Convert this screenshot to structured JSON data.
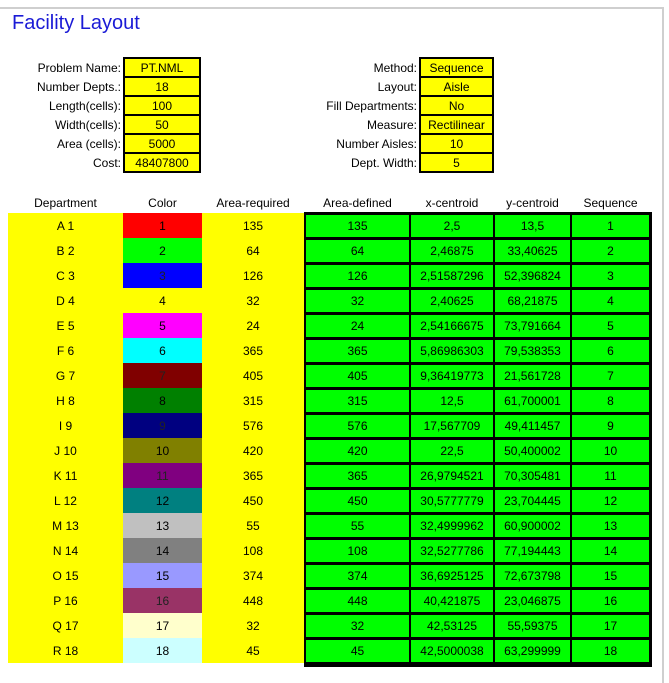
{
  "title": "Facility Layout",
  "left_params": [
    {
      "label": "Problem Name:",
      "value": "PT.NML"
    },
    {
      "label": "Number Depts.:",
      "value": "18"
    },
    {
      "label": "Length(cells):",
      "value": "100"
    },
    {
      "label": "Width(cells):",
      "value": "50"
    },
    {
      "label": "Area (cells):",
      "value": "5000"
    },
    {
      "label": "Cost:",
      "value": "48407800"
    }
  ],
  "right_params": [
    {
      "label": "Method:",
      "value": "Sequence"
    },
    {
      "label": "Layout:",
      "value": "Aisle"
    },
    {
      "label": "Fill Departments:",
      "value": "No"
    },
    {
      "label": "Measure:",
      "value": "Rectilinear"
    },
    {
      "label": "Number Aisles:",
      "value": "10"
    },
    {
      "label": "Dept. Width:",
      "value": "5"
    }
  ],
  "table": {
    "headers": [
      "Department",
      "Color",
      "Area-required",
      "Area-defined",
      "x-centroid",
      "y-centroid",
      "Sequence"
    ],
    "rows": [
      {
        "dept": "A 1",
        "color": "1",
        "color_hex": "#ff0000",
        "area_req": "135",
        "area_def": "135",
        "x": "2,5",
        "y": "13,5",
        "seq": "1"
      },
      {
        "dept": "B 2",
        "color": "2",
        "color_hex": "#00ff00",
        "area_req": "64",
        "area_def": "64",
        "x": "2,46875",
        "y": "33,40625",
        "seq": "2"
      },
      {
        "dept": "C 3",
        "color": "3",
        "color_hex": "#0000ff",
        "area_req": "126",
        "area_def": "126",
        "x": "2,51587296",
        "y": "52,396824",
        "seq": "3"
      },
      {
        "dept": "D 4",
        "color": "4",
        "color_hex": "#ffff00",
        "area_req": "32",
        "area_def": "32",
        "x": "2,40625",
        "y": "68,21875",
        "seq": "4"
      },
      {
        "dept": "E 5",
        "color": "5",
        "color_hex": "#ff00ff",
        "area_req": "24",
        "area_def": "24",
        "x": "2,54166675",
        "y": "73,791664",
        "seq": "5"
      },
      {
        "dept": "F 6",
        "color": "6",
        "color_hex": "#00ffff",
        "area_req": "365",
        "area_def": "365",
        "x": "5,86986303",
        "y": "79,538353",
        "seq": "6"
      },
      {
        "dept": "G 7",
        "color": "7",
        "color_hex": "#800000",
        "area_req": "405",
        "area_def": "405",
        "x": "9,36419773",
        "y": "21,561728",
        "seq": "7"
      },
      {
        "dept": "H 8",
        "color": "8",
        "color_hex": "#008000",
        "area_req": "315",
        "area_def": "315",
        "x": "12,5",
        "y": "61,700001",
        "seq": "8"
      },
      {
        "dept": "I 9",
        "color": "9",
        "color_hex": "#000080",
        "area_req": "576",
        "area_def": "576",
        "x": "17,567709",
        "y": "49,411457",
        "seq": "9"
      },
      {
        "dept": "J 10",
        "color": "10",
        "color_hex": "#808000",
        "area_req": "420",
        "area_def": "420",
        "x": "22,5",
        "y": "50,400002",
        "seq": "10"
      },
      {
        "dept": "K 11",
        "color": "11",
        "color_hex": "#800080",
        "area_req": "365",
        "area_def": "365",
        "x": "26,9794521",
        "y": "70,305481",
        "seq": "11"
      },
      {
        "dept": "L 12",
        "color": "12",
        "color_hex": "#008080",
        "area_req": "450",
        "area_def": "450",
        "x": "30,5777779",
        "y": "23,704445",
        "seq": "12"
      },
      {
        "dept": "M 13",
        "color": "13",
        "color_hex": "#c0c0c0",
        "area_req": "55",
        "area_def": "55",
        "x": "32,4999962",
        "y": "60,900002",
        "seq": "13"
      },
      {
        "dept": "N 14",
        "color": "14",
        "color_hex": "#808080",
        "area_req": "108",
        "area_def": "108",
        "x": "32,5277786",
        "y": "77,194443",
        "seq": "14"
      },
      {
        "dept": "O 15",
        "color": "15",
        "color_hex": "#9999ff",
        "area_req": "374",
        "area_def": "374",
        "x": "36,6925125",
        "y": "72,673798",
        "seq": "15"
      },
      {
        "dept": "P 16",
        "color": "16",
        "color_hex": "#993366",
        "area_req": "448",
        "area_def": "448",
        "x": "40,421875",
        "y": "23,046875",
        "seq": "16"
      },
      {
        "dept": "Q 17",
        "color": "17",
        "color_hex": "#ffffcc",
        "area_req": "32",
        "area_def": "32",
        "x": "42,53125",
        "y": "55,59375",
        "seq": "17"
      },
      {
        "dept": "R 18",
        "color": "18",
        "color_hex": "#ccffff",
        "area_req": "45",
        "area_def": "45",
        "x": "42,5000038",
        "y": "63,299999",
        "seq": "18"
      }
    ]
  }
}
